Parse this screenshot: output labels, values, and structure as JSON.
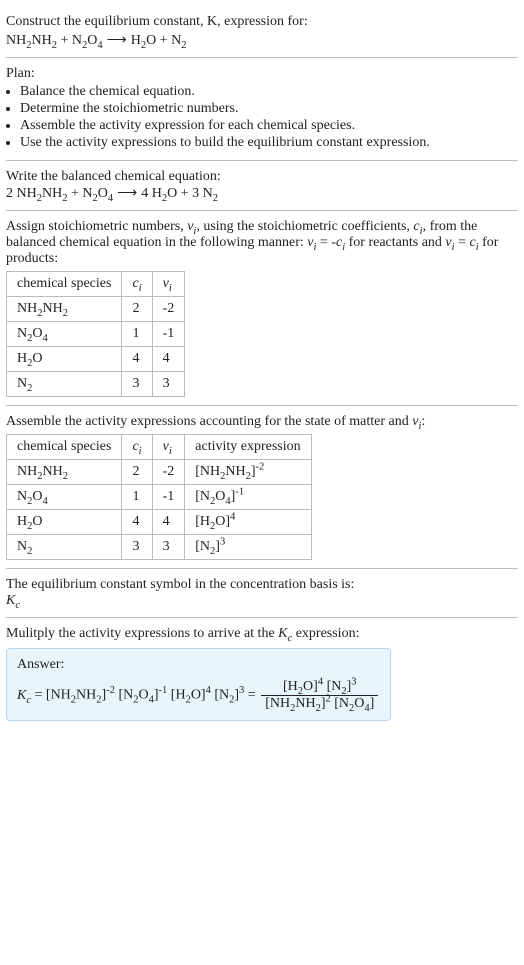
{
  "header": {
    "prompt": "Construct the equilibrium constant, K, expression for:"
  },
  "plan": {
    "label": "Plan:",
    "items": [
      "Balance the chemical equation.",
      "Determine the stoichiometric numbers.",
      "Assemble the activity expression for each chemical species.",
      "Use the activity expressions to build the equilibrium constant expression."
    ]
  },
  "balanced": {
    "label": "Write the balanced chemical equation:"
  },
  "stoich": {
    "intro_a": "Assign stoichiometric numbers, ",
    "intro_b": ", using the stoichiometric coefficients, ",
    "intro_c": ", from the balanced chemical equation in the following manner: ",
    "intro_d": " for reactants and ",
    "intro_e": " for products:",
    "headers": {
      "species": "chemical species"
    },
    "rows": [
      {
        "ci": "2",
        "vi": "-2"
      },
      {
        "ci": "1",
        "vi": "-1"
      },
      {
        "ci": "4",
        "vi": "4"
      },
      {
        "ci": "3",
        "vi": "3"
      }
    ]
  },
  "activity": {
    "intro_a": "Assemble the activity expressions accounting for the state of matter and ",
    "intro_b": ":",
    "headers": {
      "species": "chemical species",
      "expr": "activity expression"
    },
    "rows": [
      {
        "ci": "2",
        "vi": "-2"
      },
      {
        "ci": "1",
        "vi": "-1"
      },
      {
        "ci": "4",
        "vi": "4"
      },
      {
        "ci": "3",
        "vi": "3"
      }
    ]
  },
  "kc_symbol": {
    "label": "The equilibrium constant symbol in the concentration basis is:"
  },
  "multiply": {
    "label_a": "Mulitply the activity expressions to arrive at the ",
    "label_b": " expression:"
  },
  "answer": {
    "label": "Answer:"
  }
}
